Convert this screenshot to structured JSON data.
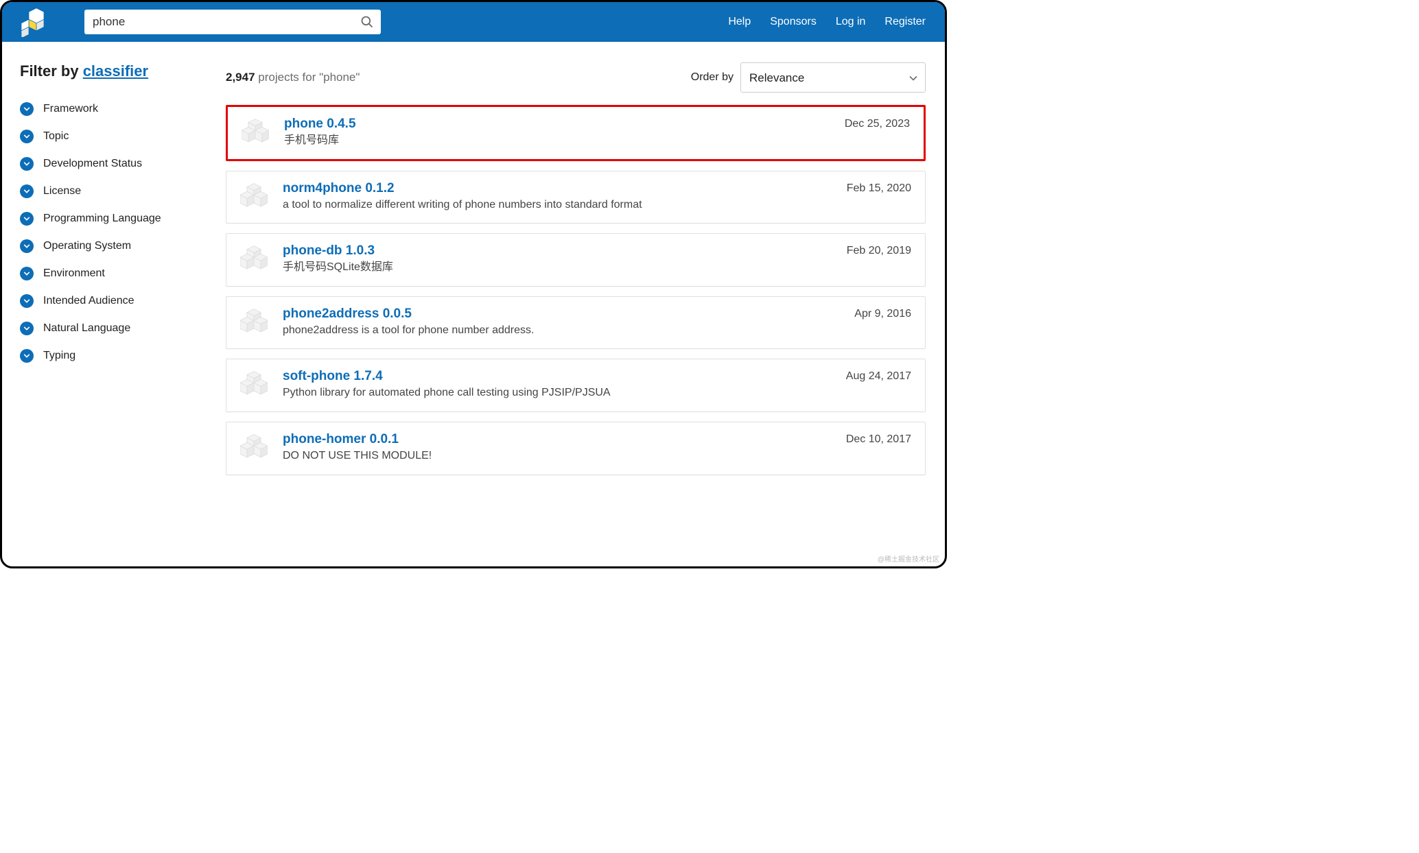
{
  "search": {
    "value": "phone"
  },
  "nav": {
    "help": "Help",
    "sponsors": "Sponsors",
    "login": "Log in",
    "register": "Register"
  },
  "sidebar": {
    "title_prefix": "Filter by ",
    "title_link": "classifier",
    "filters": [
      {
        "label": "Framework"
      },
      {
        "label": "Topic"
      },
      {
        "label": "Development Status"
      },
      {
        "label": "License"
      },
      {
        "label": "Programming Language"
      },
      {
        "label": "Operating System"
      },
      {
        "label": "Environment"
      },
      {
        "label": "Intended Audience"
      },
      {
        "label": "Natural Language"
      },
      {
        "label": "Typing"
      }
    ]
  },
  "results": {
    "count": "2,947",
    "count_suffix": " projects for \"phone\"",
    "order_label": "Order by",
    "order_value": "Relevance",
    "items": [
      {
        "name": "phone 0.4.5",
        "desc": "手机号码库",
        "date": "Dec 25, 2023",
        "highlighted": true
      },
      {
        "name": "norm4phone 0.1.2",
        "desc": "a tool to normalize different writing of phone numbers into standard format",
        "date": "Feb 15, 2020",
        "highlighted": false
      },
      {
        "name": "phone-db 1.0.3",
        "desc": "手机号码SQLite数据库",
        "date": "Feb 20, 2019",
        "highlighted": false
      },
      {
        "name": "phone2address 0.0.5",
        "desc": "phone2address is a tool for phone number address.",
        "date": "Apr 9, 2016",
        "highlighted": false
      },
      {
        "name": "soft-phone 1.7.4",
        "desc": "Python library for automated phone call testing using PJSIP/PJSUA",
        "date": "Aug 24, 2017",
        "highlighted": false
      },
      {
        "name": "phone-homer 0.0.1",
        "desc": "DO NOT USE THIS MODULE!",
        "date": "Dec 10, 2017",
        "highlighted": false
      }
    ]
  },
  "watermark": "@稀土掘金技术社区"
}
